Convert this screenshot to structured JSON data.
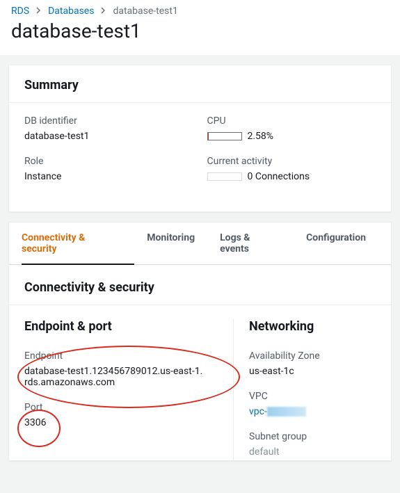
{
  "breadcrumb": {
    "root": "RDS",
    "second": "Databases",
    "current": "database-test1"
  },
  "page_title": "database-test1",
  "summary": {
    "heading": "Summary",
    "db_identifier_label": "DB identifier",
    "db_identifier_value": "database-test1",
    "role_label": "Role",
    "role_value": "Instance",
    "cpu_label": "CPU",
    "cpu_value": "2.58%",
    "cpu_percent": 2.58,
    "current_activity_label": "Current activity",
    "current_activity_value": "0 Connections"
  },
  "tabs": {
    "t0": "Connectivity & security",
    "t1": "Monitoring",
    "t2": "Logs & events",
    "t3": "Configuration"
  },
  "conn": {
    "section_title": "Connectivity & security",
    "endpoint_port_heading": "Endpoint & port",
    "endpoint_label": "Endpoint",
    "endpoint_value": "database-test1.123456789012.us-east-1.rds.amazonaws.com",
    "port_label": "Port",
    "port_value": "3306",
    "networking_heading": "Networking",
    "az_label": "Availability Zone",
    "az_value": "us-east-1c",
    "vpc_label": "VPC",
    "vpc_prefix": "vpc-",
    "subnet_label": "Subnet group",
    "subnet_value": "default"
  }
}
